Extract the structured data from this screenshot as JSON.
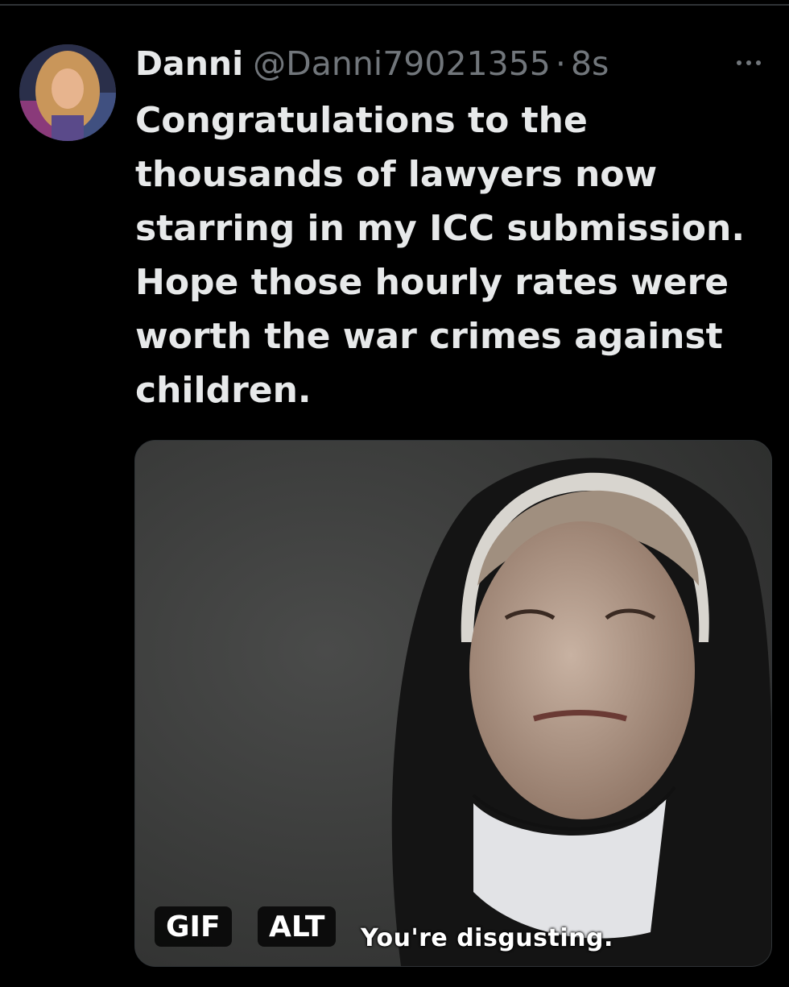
{
  "tweet": {
    "author": {
      "display_name": "Danni",
      "handle": "@Danni79021355",
      "separator": "·",
      "timestamp": "8s",
      "avatar_icon": "profile-photo"
    },
    "more_icon": "more-dots-icon",
    "text": "Congratulations to the thousands of lawyers now starring in my ICC submission. Hope those hourly rates were worth the war crimes against children.",
    "media": {
      "type": "gif",
      "gif_badge": "GIF",
      "alt_badge": "ALT",
      "subtitle": "You're disgusting."
    }
  },
  "colors": {
    "background": "#000000",
    "primary_text": "#e7e9ea",
    "secondary_text": "#71767b"
  }
}
